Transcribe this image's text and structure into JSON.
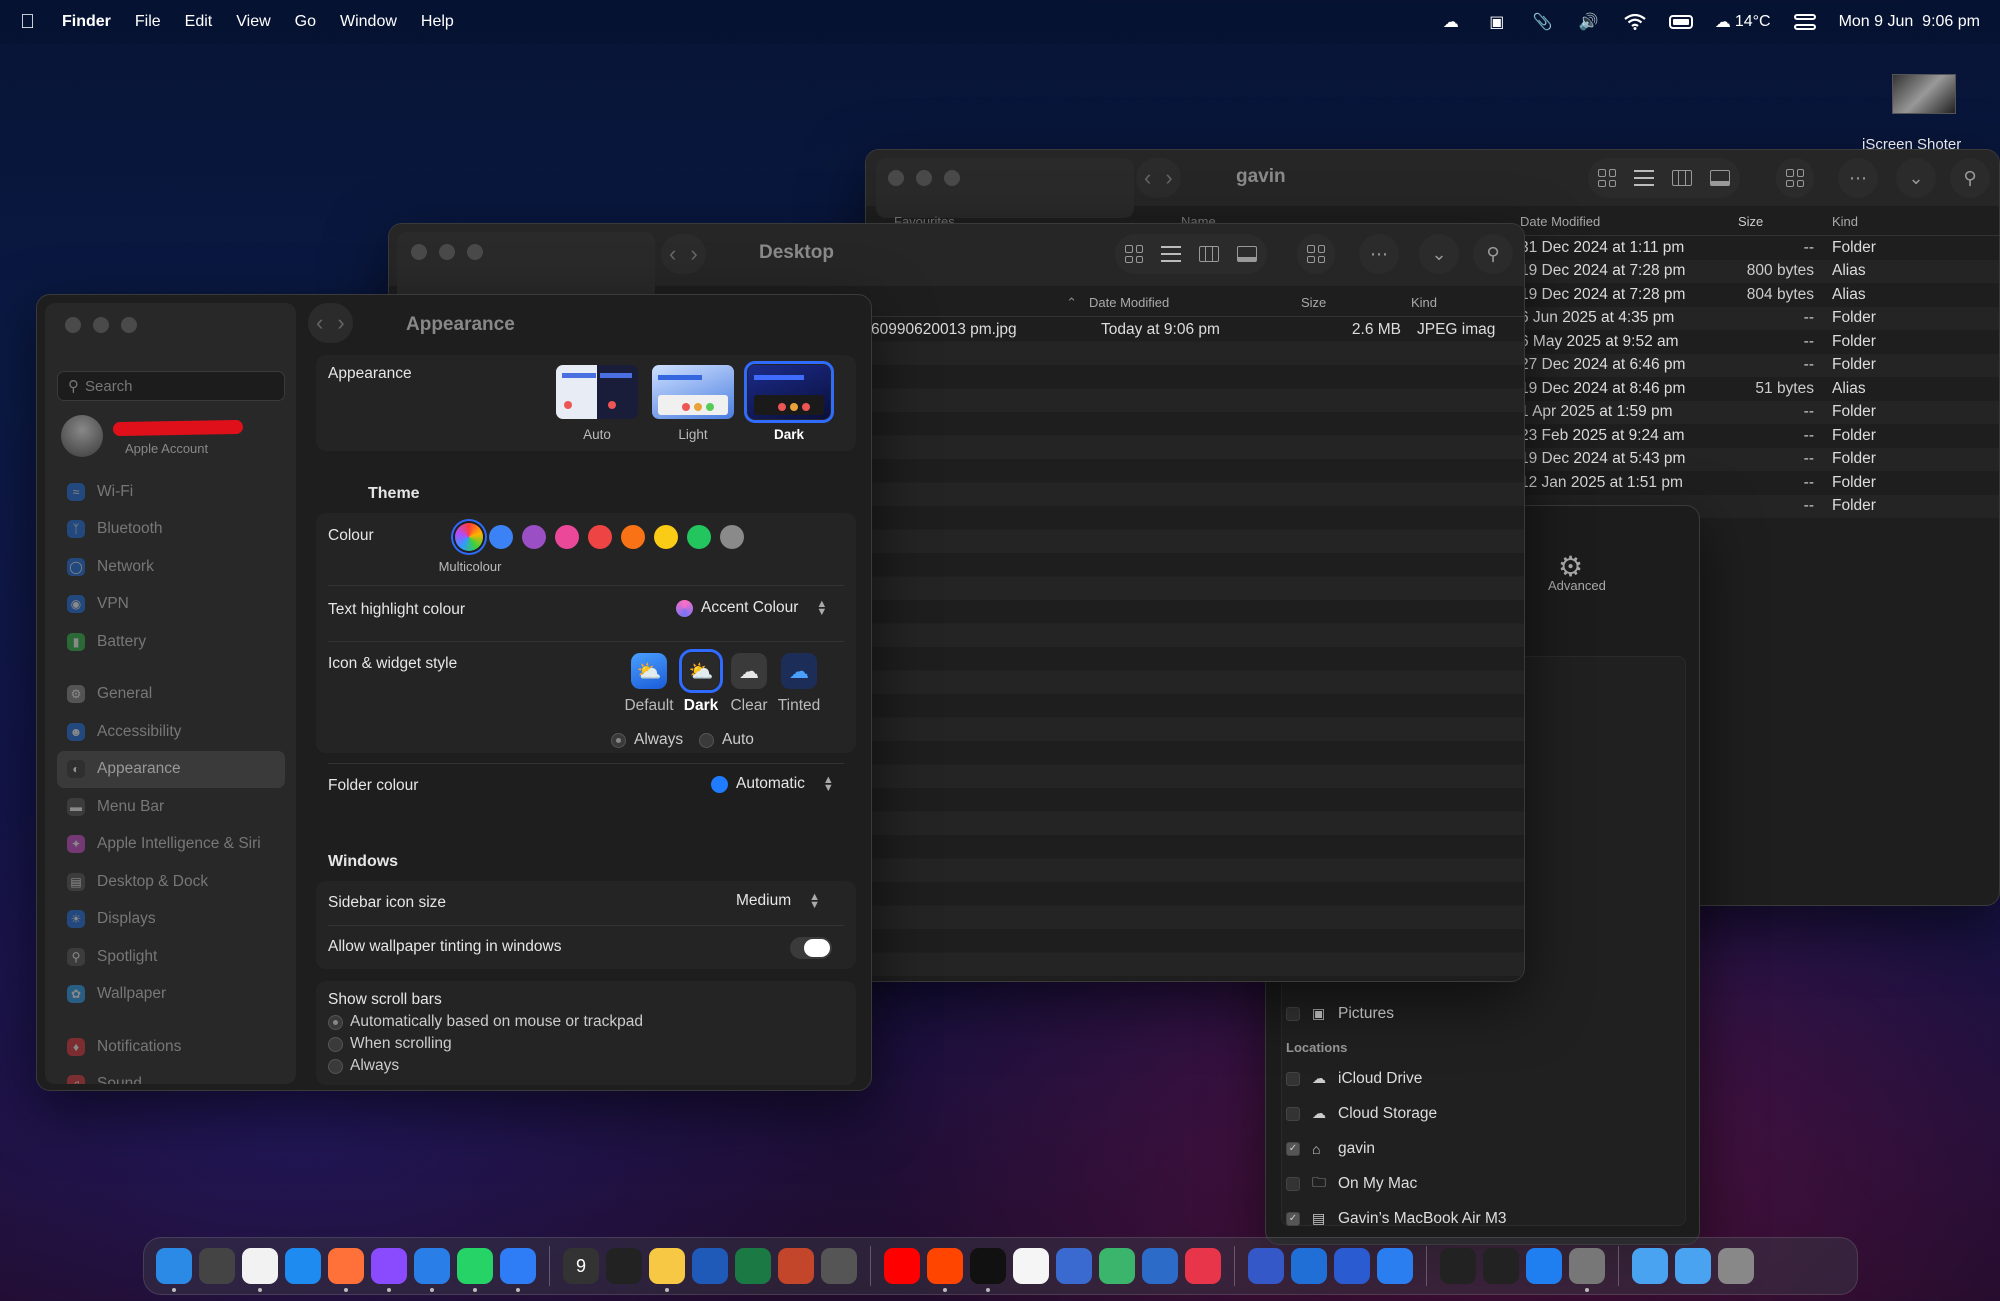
{
  "menubar": {
    "app": "Finder",
    "items": [
      "File",
      "Edit",
      "View",
      "Go",
      "Window",
      "Help"
    ],
    "temperature": "14°C",
    "datetime": "Mon 9 Jun  9:06 pm",
    "icons": [
      "apple-icon",
      "cloud-icon",
      "screenshot-icon",
      "paperclip-icon",
      "volume-icon",
      "wifi-icon",
      "battery-icon",
      "weather-cloud-icon",
      "control-center-icon"
    ]
  },
  "desktop_thumbnail": {
    "label": "iScreen Shoter"
  },
  "finder_gavin": {
    "title": "gavin",
    "sidebar_header": "Favourites",
    "name_header": "Name",
    "columns": {
      "date": "Date Modified",
      "size": "Size",
      "kind": "Kind"
    },
    "rows": [
      {
        "date": "31 Dec 2024 at 1:11 pm",
        "size": "--",
        "kind": "Folder"
      },
      {
        "date": "19 Dec 2024 at 7:28 pm",
        "size": "800 bytes",
        "kind": "Alias"
      },
      {
        "date": "19 Dec 2024 at 7:28 pm",
        "size": "804 bytes",
        "kind": "Alias"
      },
      {
        "date": "6 Jun 2025 at 4:35 pm",
        "size": "--",
        "kind": "Folder"
      },
      {
        "date": "6 May 2025 at 9:52 am",
        "size": "--",
        "kind": "Folder"
      },
      {
        "date": "27 Dec 2024 at 6:46 pm",
        "size": "--",
        "kind": "Folder"
      },
      {
        "date": "19 Dec 2024 at 8:46 pm",
        "size": "51 bytes",
        "kind": "Alias"
      },
      {
        "date": "1 Apr 2025 at 1:59 pm",
        "size": "--",
        "kind": "Folder"
      },
      {
        "date": "23 Feb 2025 at 9:24 am",
        "size": "--",
        "kind": "Folder"
      },
      {
        "date": "19 Dec 2024 at 5:43 pm",
        "size": "--",
        "kind": "Folder"
      },
      {
        "date": "12 Jan 2025 at 1:51 pm",
        "size": "--",
        "kind": "Folder"
      },
      {
        "date": "",
        "size": "--",
        "kind": "Folder"
      }
    ]
  },
  "settings_back": {
    "advanced_label": "Advanced",
    "items": [
      {
        "label": "Pictures",
        "icon": "pictures-icon"
      },
      {
        "section": "Locations"
      },
      {
        "label": "iCloud Drive",
        "icon": "cloud-icon"
      },
      {
        "label": "Cloud Storage",
        "icon": "cloud-icon"
      },
      {
        "label": "gavin",
        "icon": "home-icon",
        "checked": true
      },
      {
        "label": "On My Mac",
        "icon": "folder-icon"
      },
      {
        "label": "Gavin’s MacBook Air M3",
        "icon": "laptop-icon",
        "checked": true
      }
    ]
  },
  "finder_desktop": {
    "title": "Desktop",
    "columns": {
      "date": "Date Modified",
      "size": "Size",
      "kind": "Kind"
    },
    "file": {
      "name": "60990620013 pm.jpg",
      "date": "Today at 9:06 pm",
      "size": "2.6 MB",
      "kind": "JPEG imag"
    }
  },
  "appearance": {
    "title": "Appearance",
    "sidebar": {
      "search_placeholder": "Search",
      "account_label": "Apple Account",
      "groups": [
        [
          {
            "label": "Wi-Fi",
            "icon": "wifi-icon",
            "color": "#1f6fe5"
          },
          {
            "label": "Bluetooth",
            "icon": "bluetooth-icon",
            "color": "#1f6fe5"
          },
          {
            "label": "Network",
            "icon": "globe-icon",
            "color": "#1f6fe5"
          },
          {
            "label": "VPN",
            "icon": "vpn-icon",
            "color": "#1f6fe5"
          },
          {
            "label": "Battery",
            "icon": "battery-icon",
            "color": "#2fb84b"
          }
        ],
        [
          {
            "label": "General",
            "icon": "gear-icon",
            "color": "#8a8a8a"
          },
          {
            "label": "Accessibility",
            "icon": "accessibility-icon",
            "color": "#1f6fe5"
          },
          {
            "label": "Appearance",
            "icon": "appearance-icon",
            "color": "#222222",
            "active": true
          },
          {
            "label": "Menu Bar",
            "icon": "menubar-icon",
            "color": "#555555"
          },
          {
            "label": "Apple Intelligence & Siri",
            "icon": "siri-icon",
            "color": "#d04fd0"
          },
          {
            "label": "Desktop & Dock",
            "icon": "dock-icon",
            "color": "#555555"
          },
          {
            "label": "Displays",
            "icon": "display-icon",
            "color": "#1f6fe5"
          },
          {
            "label": "Spotlight",
            "icon": "spotlight-icon",
            "color": "#555555"
          },
          {
            "label": "Wallpaper",
            "icon": "wallpaper-icon",
            "color": "#2a9df4"
          }
        ],
        [
          {
            "label": "Notifications",
            "icon": "bell-icon",
            "color": "#e0353b"
          },
          {
            "label": "Sound",
            "icon": "sound-icon",
            "color": "#e0353b"
          }
        ]
      ]
    },
    "appearance_row": {
      "label": "Appearance",
      "options": [
        "Auto",
        "Light",
        "Dark"
      ],
      "selected": "Dark"
    },
    "theme_title": "Theme",
    "colour": {
      "label": "Colour",
      "selected_label": "Multicolour",
      "swatches": [
        "#3b82f6",
        "#9b4fc4",
        "#ec4899",
        "#ef4444",
        "#f97316",
        "#facc15",
        "#22c55e",
        "#8a8a8a"
      ]
    },
    "highlight": {
      "label": "Text highlight colour",
      "value": "Accent Colour"
    },
    "icon_style": {
      "label": "Icon & widget style",
      "options": [
        "Default",
        "Dark",
        "Clear",
        "Tinted"
      ],
      "selected": "Dark",
      "radios": [
        "Always",
        "Auto"
      ]
    },
    "folder": {
      "label": "Folder colour",
      "value": "Automatic"
    },
    "windows_title": "Windows",
    "sidebar_icon": {
      "label": "Sidebar icon size",
      "value": "Medium"
    },
    "tinting": {
      "label": "Allow wallpaper tinting in windows",
      "on": true
    },
    "scroll": {
      "label": "Show scroll bars",
      "options": [
        "Automatically based on mouse or trackpad",
        "When scrolling",
        "Always"
      ]
    }
  },
  "dock": {
    "apps": [
      {
        "name": "finder",
        "color": "#2b8ae6",
        "run": true
      },
      {
        "name": "launchpad",
        "color": "#444"
      },
      {
        "name": "chrome",
        "color": "#f2f2f2",
        "run": true
      },
      {
        "name": "safari",
        "color": "#1d8bf0"
      },
      {
        "name": "firefox",
        "color": "#ff7139",
        "run": true
      },
      {
        "name": "firefox-dev",
        "color": "#8a4bff",
        "run": true
      },
      {
        "name": "mail",
        "color": "#2a7ee8",
        "run": true
      },
      {
        "name": "whatsapp",
        "color": "#25d366",
        "run": true
      },
      {
        "name": "messenger",
        "color": "#2e7cf6",
        "run": true
      },
      {
        "name": "sep"
      },
      {
        "name": "calendar",
        "color": "#333",
        "text": "9"
      },
      {
        "name": "reminders",
        "color": "#222"
      },
      {
        "name": "notes",
        "color": "#f6c844",
        "run": true
      },
      {
        "name": "word",
        "color": "#1f5ab8"
      },
      {
        "name": "excel",
        "color": "#1b7a43"
      },
      {
        "name": "powerpoint",
        "color": "#c4462a"
      },
      {
        "name": "calculator",
        "color": "#555"
      },
      {
        "name": "sep"
      },
      {
        "name": "youtube",
        "color": "#ff0000"
      },
      {
        "name": "reddit",
        "color": "#ff4500",
        "run": true
      },
      {
        "name": "tv",
        "color": "#111",
        "run": true
      },
      {
        "name": "photos",
        "color": "#f5f5f5"
      },
      {
        "name": "instruments",
        "color": "#3a6ad0"
      },
      {
        "name": "maps",
        "color": "#3bb56b"
      },
      {
        "name": "weather",
        "color": "#2c6cc8"
      },
      {
        "name": "news",
        "color": "#e8354a"
      },
      {
        "name": "sep"
      },
      {
        "name": "messenger-2",
        "color": "#3458c8"
      },
      {
        "name": "windows",
        "color": "#1f6fd6"
      },
      {
        "name": "screen",
        "color": "#2a5bd0"
      },
      {
        "name": "windows-app",
        "color": "#2a7ef0"
      },
      {
        "name": "sep"
      },
      {
        "name": "terminal",
        "color": "#222"
      },
      {
        "name": "activity-monitor",
        "color": "#222"
      },
      {
        "name": "app-store",
        "color": "#1f7ff0"
      },
      {
        "name": "system-settings",
        "color": "#777",
        "run": true
      },
      {
        "name": "sep"
      },
      {
        "name": "downloads",
        "color": "#4aa3f0"
      },
      {
        "name": "applications",
        "color": "#4aa3f0"
      },
      {
        "name": "trash",
        "color": "#888"
      }
    ]
  }
}
